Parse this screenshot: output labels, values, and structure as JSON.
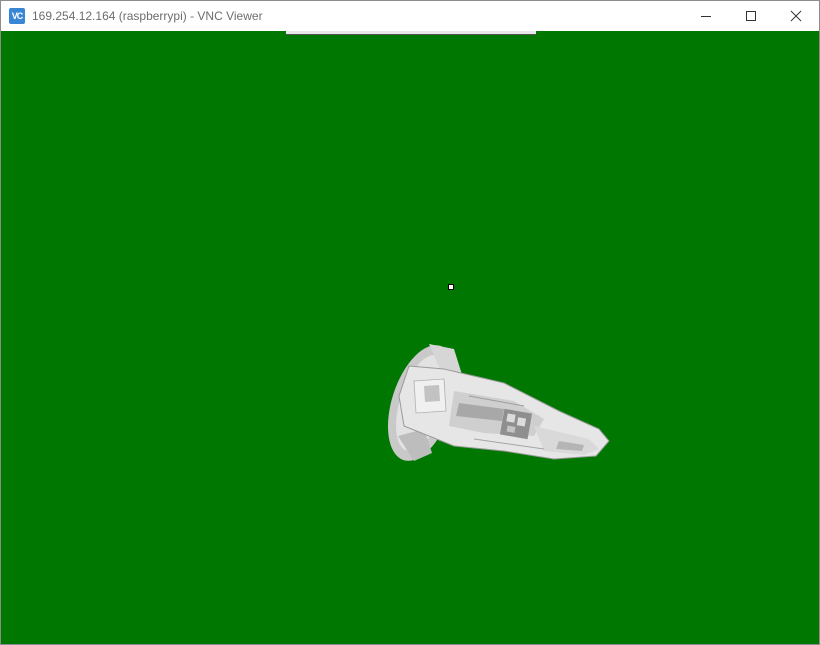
{
  "window": {
    "title": "169.254.12.164 (raspberrypi) - VNC Viewer",
    "app_icon_text": "VC",
    "buttons": {
      "minimize": "minimize-icon",
      "maximize": "maximize-icon",
      "close": "close-icon"
    }
  },
  "remote_screen": {
    "background_color": "#007700",
    "scene_object": "spaceship-model"
  },
  "colors": {
    "titlebar": "#ffffff",
    "title_text": "#6d6d6d",
    "app_icon": "#3a86d6"
  }
}
